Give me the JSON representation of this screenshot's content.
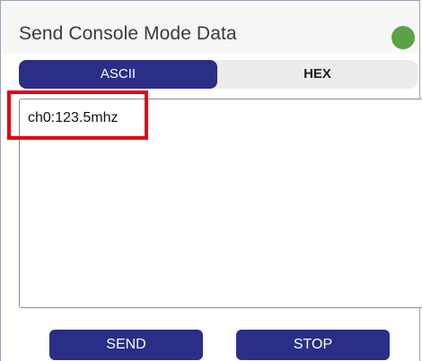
{
  "header": {
    "title": "Send Console Mode Data",
    "status_color": "#59a245"
  },
  "mode_tabs": {
    "selected": "ASCII",
    "items": [
      {
        "label": "ASCII"
      },
      {
        "label": "HEX"
      }
    ]
  },
  "input": {
    "value": "ch0:123.5mhz"
  },
  "buttons": {
    "send_label": "SEND",
    "stop_label": "STOP"
  },
  "colors": {
    "accent": "#2a2e86",
    "highlight": "#e60012"
  }
}
